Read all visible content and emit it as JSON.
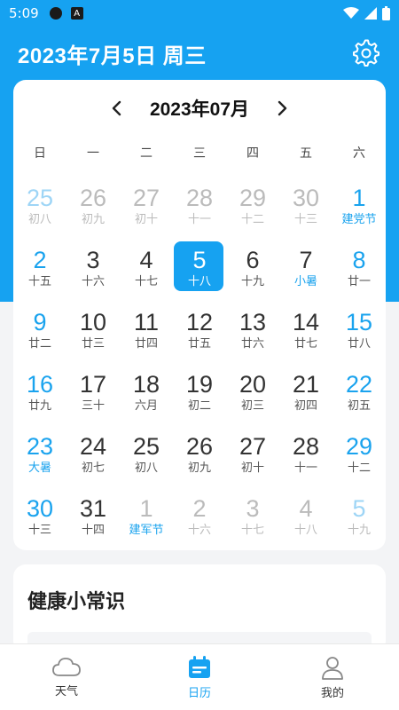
{
  "status_bar": {
    "time": "5:09",
    "a_label": "A"
  },
  "header": {
    "title": "2023年7月5日 周三"
  },
  "calendar": {
    "month_label": "2023年07月",
    "weekdays": [
      "日",
      "一",
      "二",
      "三",
      "四",
      "五",
      "六"
    ],
    "days": [
      {
        "n": "25",
        "s": "初八",
        "other": true,
        "weekend": true
      },
      {
        "n": "26",
        "s": "初九",
        "other": true
      },
      {
        "n": "27",
        "s": "初十",
        "other": true
      },
      {
        "n": "28",
        "s": "十一",
        "other": true
      },
      {
        "n": "29",
        "s": "十二",
        "other": true
      },
      {
        "n": "30",
        "s": "十三",
        "other": true
      },
      {
        "n": "1",
        "s": "建党节",
        "weekend": true,
        "festival": true
      },
      {
        "n": "2",
        "s": "十五",
        "weekend": true
      },
      {
        "n": "3",
        "s": "十六"
      },
      {
        "n": "4",
        "s": "十七"
      },
      {
        "n": "5",
        "s": "十八",
        "today": true
      },
      {
        "n": "6",
        "s": "十九"
      },
      {
        "n": "7",
        "s": "小暑",
        "festival": true
      },
      {
        "n": "8",
        "s": "廿一",
        "weekend": true
      },
      {
        "n": "9",
        "s": "廿二",
        "weekend": true
      },
      {
        "n": "10",
        "s": "廿三"
      },
      {
        "n": "11",
        "s": "廿四"
      },
      {
        "n": "12",
        "s": "廿五"
      },
      {
        "n": "13",
        "s": "廿六"
      },
      {
        "n": "14",
        "s": "廿七"
      },
      {
        "n": "15",
        "s": "廿八",
        "weekend": true
      },
      {
        "n": "16",
        "s": "廿九",
        "weekend": true
      },
      {
        "n": "17",
        "s": "三十"
      },
      {
        "n": "18",
        "s": "六月"
      },
      {
        "n": "19",
        "s": "初二"
      },
      {
        "n": "20",
        "s": "初三"
      },
      {
        "n": "21",
        "s": "初四"
      },
      {
        "n": "22",
        "s": "初五",
        "weekend": true
      },
      {
        "n": "23",
        "s": "大暑",
        "weekend": true,
        "festival": true
      },
      {
        "n": "24",
        "s": "初七"
      },
      {
        "n": "25",
        "s": "初八"
      },
      {
        "n": "26",
        "s": "初九"
      },
      {
        "n": "27",
        "s": "初十"
      },
      {
        "n": "28",
        "s": "十一"
      },
      {
        "n": "29",
        "s": "十二",
        "weekend": true
      },
      {
        "n": "30",
        "s": "十三",
        "weekend": true
      },
      {
        "n": "31",
        "s": "十四"
      },
      {
        "n": "1",
        "s": "建军节",
        "other": true,
        "festival": true
      },
      {
        "n": "2",
        "s": "十六",
        "other": true
      },
      {
        "n": "3",
        "s": "十七",
        "other": true
      },
      {
        "n": "4",
        "s": "十八",
        "other": true
      },
      {
        "n": "5",
        "s": "十九",
        "other": true,
        "weekend": true
      }
    ]
  },
  "health": {
    "title": "健康小常识"
  },
  "bottom_nav": [
    {
      "label": "天气",
      "icon": "cloud-icon"
    },
    {
      "label": "日历",
      "icon": "calendar-icon",
      "active": true
    },
    {
      "label": "我的",
      "icon": "person-icon"
    }
  ],
  "colors": {
    "accent": "#16a2f1",
    "weekend": "#1aa3ee",
    "other_month": "#bbbbbb"
  }
}
